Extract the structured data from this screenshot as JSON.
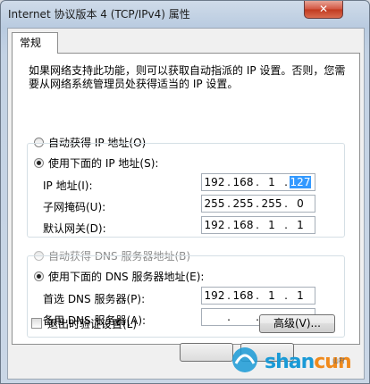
{
  "window": {
    "title": "Internet 协议版本 4 (TCP/IPv4) 属性",
    "close_glyph": "✕"
  },
  "tabs": [
    {
      "label": "常规",
      "active": true
    }
  ],
  "description": "如果网络支持此功能，则可以获取自动指派的 IP 设置。否则，您需要从网络系统管理员处获得适当的 IP 设置。",
  "ip_section": {
    "auto_label": "自动获得 IP 地址(O)",
    "auto_selected": false,
    "manual_label": "使用下面的 IP 地址(S):",
    "manual_selected": true,
    "fields": [
      {
        "label": "IP 地址(I):",
        "octets": [
          "192",
          "168",
          "1",
          "127"
        ],
        "selected_octet": 3
      },
      {
        "label": "子网掩码(U):",
        "octets": [
          "255",
          "255",
          "255",
          "0"
        ]
      },
      {
        "label": "默认网关(D):",
        "octets": [
          "192",
          "168",
          "1",
          "1"
        ]
      }
    ]
  },
  "dns_section": {
    "auto_label": "自动获得 DNS 服务器地址(B)",
    "auto_selected": false,
    "auto_disabled": true,
    "manual_label": "使用下面的 DNS 服务器地址(E):",
    "manual_selected": true,
    "fields": [
      {
        "label": "首选 DNS 服务器(P):",
        "octets": [
          "192",
          "168",
          "1",
          "1"
        ]
      },
      {
        "label": "备用 DNS 服务器(A):",
        "octets": [
          "",
          "",
          "",
          ""
        ]
      }
    ]
  },
  "validate_checkbox": {
    "label": "退出时验证设置(L)",
    "checked": false
  },
  "advanced_button": "高级(V)...",
  "watermark": {
    "brand": "shan",
    "brand2": "cun",
    "suffix": ".net",
    "sub": "山村"
  },
  "colors": {
    "selection": "#3399ff",
    "close": "#c7432b",
    "watermark_blue": "#1a9ad6",
    "watermark_orange": "#f08a1c"
  }
}
